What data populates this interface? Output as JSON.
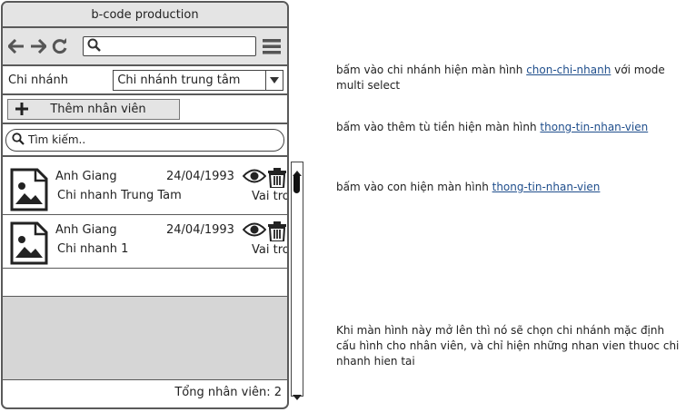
{
  "window": {
    "title": "b-code production"
  },
  "browser": {
    "url": ""
  },
  "filter": {
    "branch_label": "Chi nhánh",
    "branch_value": "Chi nhánh trung tâm"
  },
  "actions": {
    "add_label": "Thêm nhân viên"
  },
  "search": {
    "placeholder": "Tìm kiếm.."
  },
  "employees": [
    {
      "name": "Anh Giang",
      "date": "24/04/1993",
      "branch": "Chi nhanh Trung Tam",
      "role": "Vai tro"
    },
    {
      "name": "Anh Giang",
      "date": "24/04/1993",
      "branch": "Chi nhanh 1",
      "role": "Vai tro"
    }
  ],
  "footer": {
    "total": "Tổng nhân viên: 2"
  },
  "notes": [
    {
      "before": "bấm vào chi nhánh hiện màn hình ",
      "link": "chon-chi-nhanh",
      "after": " với mode multi select"
    },
    {
      "before": "bấm vào thêm tù tiền hiện màn hình ",
      "link": "thong-tin-nhan-vien",
      "after": ""
    },
    {
      "before": "bấm vào con hiện màn hình ",
      "link": "thong-tin-nhan-vien",
      "after": ""
    },
    {
      "text": "Khi màn hình này mở lên thì nó sẽ chọn chi nhánh mặc định cấu hình cho nhân viên, và chỉ hiện những nhan vien thuoc chi nhanh hien tai"
    }
  ]
}
